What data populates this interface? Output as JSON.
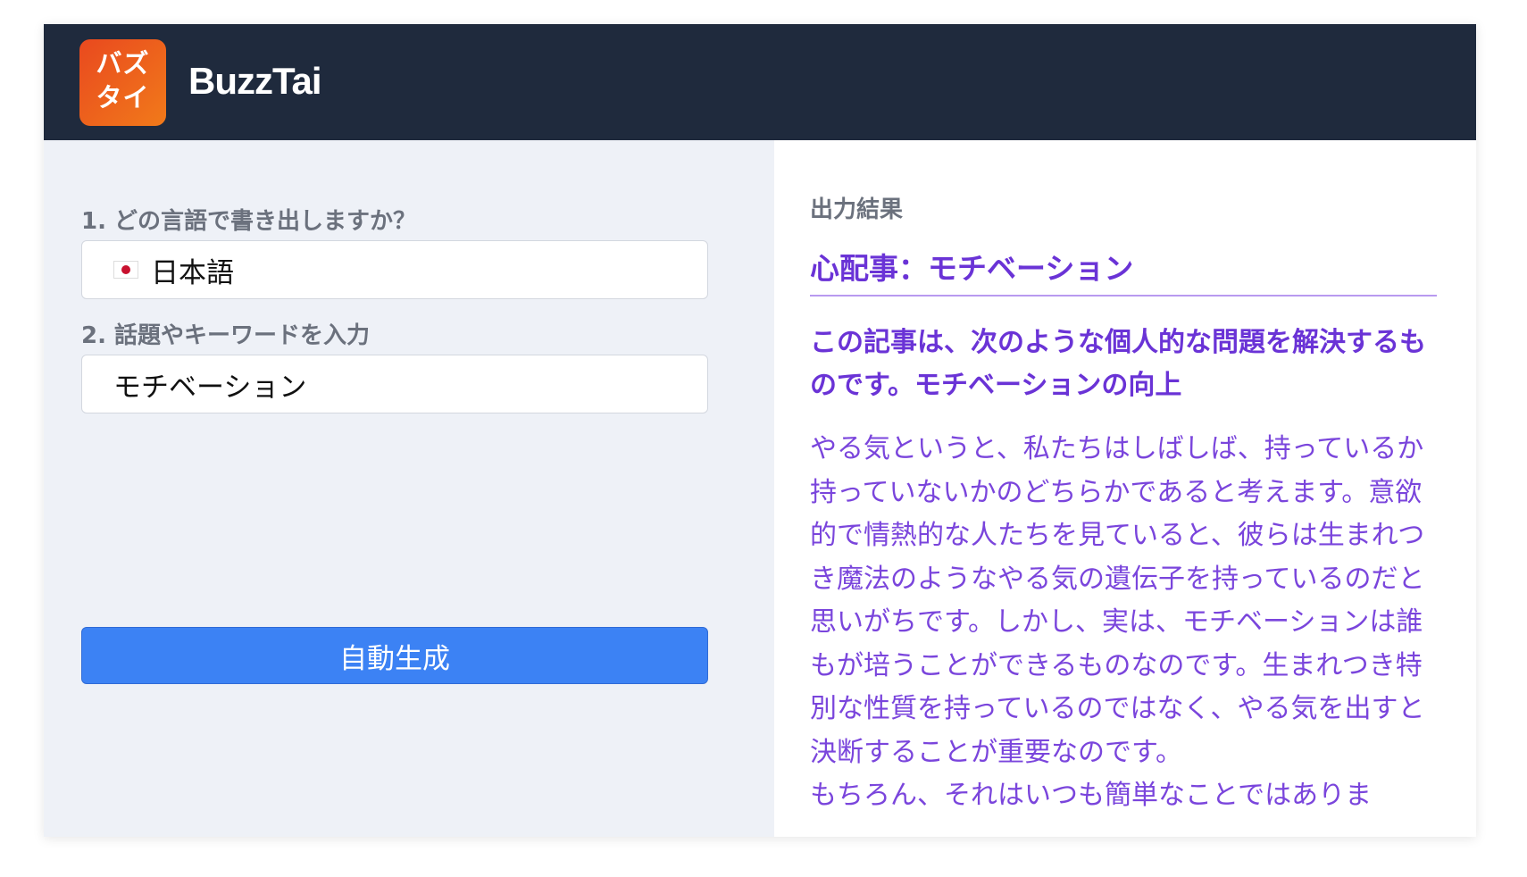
{
  "header": {
    "logo_line1": "バズ",
    "logo_line2": "タイ",
    "brand": "BuzzTai"
  },
  "form": {
    "language_label": "1. どの言語で書き出しますか？",
    "language_value": "日本語",
    "language_flag": "japan-flag-icon",
    "topic_label": "2. 話題やキーワードを入力",
    "topic_value": "モチベーション",
    "generate_button": "自動生成"
  },
  "output": {
    "label": "出力結果",
    "title": "心配事：モチベーション",
    "summary": "この記事は、次のような個人的な問題を解決するものです。モチベーションの向上",
    "paragraph1": "やる気というと、私たちはしばしば、持っているか持っていないかのどちらかであると考えます。意欲的で情熱的な人たちを見ていると、彼らは生まれつき魔法のようなやる気の遺伝子を持っているのだと思いがちです。しかし、実は、モチベーションは誰もが培うことができるものなのです。生まれつき特別な性質を持っているのではなく、やる気を出すと決断することが重要なのです。",
    "paragraph2": "もちろん、それはいつも簡単なことではありま"
  },
  "colors": {
    "header_bg": "#1f2a3d",
    "accent_purple": "#6a33d6",
    "button_blue": "#3c82f4",
    "logo_orange": "#ef5f1c"
  }
}
